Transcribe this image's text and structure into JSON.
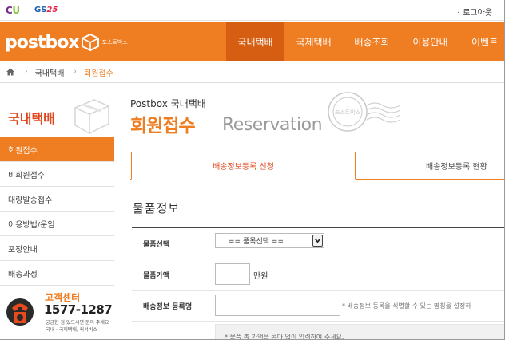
{
  "topbar": {
    "brand_cu_c": "C",
    "brand_cu_u": "U",
    "brand_gs_text": "GS",
    "brand_gs_num": "25",
    "login": "로그아웃"
  },
  "header": {
    "logo_text": "postbox",
    "logo_sub": "포스트박스",
    "nav": [
      {
        "label": "국내택배",
        "active": true
      },
      {
        "label": "국제택배"
      },
      {
        "label": "배송조회"
      },
      {
        "label": "이용안내"
      },
      {
        "label": "이벤트"
      }
    ]
  },
  "breadcrumb": {
    "items": [
      "국내택배",
      "회원접수"
    ]
  },
  "sidebar": {
    "title": "국내택배",
    "items": [
      {
        "label": "회원접수",
        "active": true
      },
      {
        "label": "비회원접수"
      },
      {
        "label": "대량발송접수"
      },
      {
        "label": "이용방법/운임"
      },
      {
        "label": "포장안내"
      },
      {
        "label": "배송과정"
      }
    ],
    "cs": {
      "title": "고객센터",
      "phone": "1577-1287",
      "desc_line1": "궁금한 점 있으시면 문의 주세요",
      "desc_line2": "국내 · 국제택배, 퀵서비스"
    }
  },
  "main": {
    "subtitle": "Postbox 국내택배",
    "title": "회원접수",
    "title_en": "Reservation",
    "stamp_text": "포스트박스",
    "tabs": [
      {
        "label": "배송정보등록 신청",
        "active": true
      },
      {
        "label": "배송정보등록 현황"
      }
    ],
    "section_title": "물품정보",
    "form": {
      "item_select_label": "물품선택",
      "item_select_value": "== 품목선택 ==",
      "price_label": "물품가액",
      "price_value": "",
      "price_unit": "만원",
      "name_label": "배송정보 등록명",
      "name_value": "",
      "name_hint": "* 배송정보 등록을 식별할 수 있는 명칭을 설정하",
      "note": "* 물품 총 가액을 콤마 없이 입력하여 주세요."
    }
  },
  "colors": {
    "brand_orange": "#ef7d22",
    "active_nav": "#d55e12",
    "accent_red": "#e0471e"
  }
}
